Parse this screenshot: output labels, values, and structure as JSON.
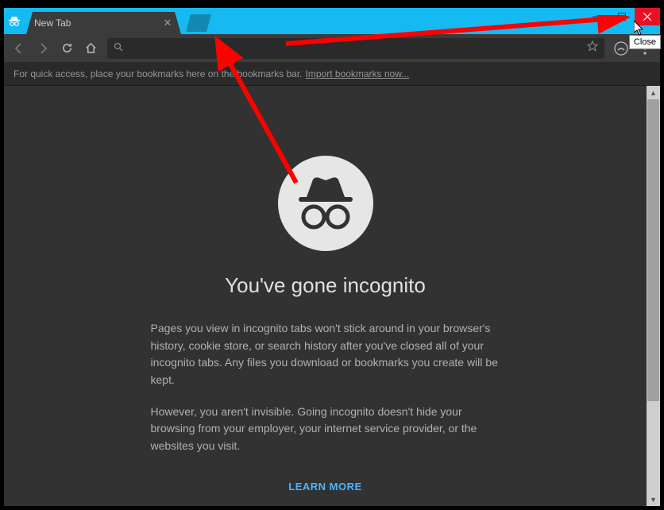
{
  "tab": {
    "title": "New Tab"
  },
  "window_controls": {
    "close_tooltip": "Close"
  },
  "omnibox": {
    "placeholder": ""
  },
  "bookmarks_bar": {
    "hint": "For quick access, place your bookmarks here on the bookmarks bar.",
    "import_link": "Import bookmarks now..."
  },
  "page": {
    "heading": "You've gone incognito",
    "para1": "Pages you view in incognito tabs won't stick around in your browser's history, cookie store, or search history after you've closed all of your incognito tabs. Any files you download or bookmarks you create will be kept.",
    "para2": "However, you aren't invisible. Going incognito doesn't hide your browsing from your employer, your internet service provider, or the websites you visit.",
    "learn_more": "LEARN MORE"
  },
  "colors": {
    "titlebar": "#15baf2",
    "close_btn": "#e81123",
    "content_bg": "#323232",
    "link": "#4cb4ff"
  }
}
